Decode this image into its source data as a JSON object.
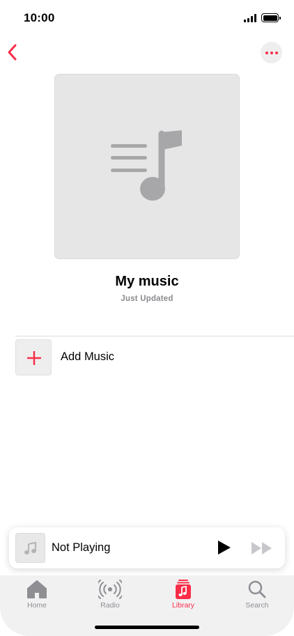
{
  "status_bar": {
    "time": "10:00"
  },
  "playlist": {
    "title": "My music",
    "subtitle": "Just Updated"
  },
  "add_music": {
    "label": "Add Music"
  },
  "mini_player": {
    "label": "Not Playing"
  },
  "tabs": [
    {
      "label": "Home",
      "icon": "home-icon"
    },
    {
      "label": "Radio",
      "icon": "radio-icon"
    },
    {
      "label": "Library",
      "icon": "library-icon",
      "active": true
    },
    {
      "label": "Search",
      "icon": "search-icon"
    }
  ],
  "colors": {
    "accent": "#fa2d48",
    "inactive": "#8e8e93",
    "artwork_bg": "#e6e6e6"
  }
}
